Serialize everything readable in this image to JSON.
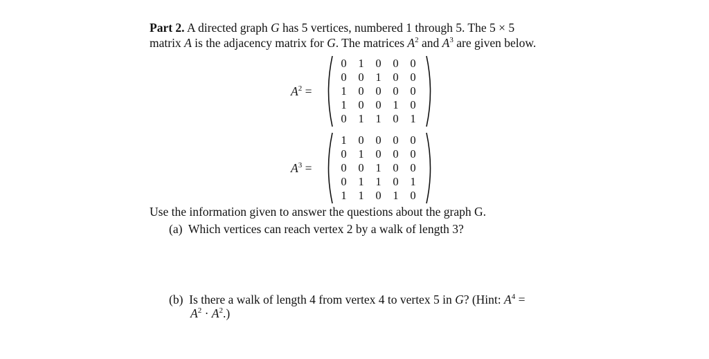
{
  "intro": {
    "part_label": "Part 2.",
    "line1_text_a": " A directed graph ",
    "graph_symbol": "G",
    "line1_text_b": " has 5 vertices, numbered 1 through 5.  The 5 × 5",
    "line2_text_a": "matrix ",
    "matrix_symbol": "A",
    "line2_text_b": " is the adjacency matrix for ",
    "line2_text_c": ". The matrices ",
    "a2_base": "A",
    "a2_exp": "2",
    "line2_text_d": " and ",
    "a3_base": "A",
    "a3_exp": "3",
    "line2_text_e": " are given below."
  },
  "matrices": [
    {
      "label_base": "A",
      "label_exp": "2",
      "equals": " =",
      "rows": [
        [
          "0",
          "1",
          "0",
          "0",
          "0"
        ],
        [
          "0",
          "0",
          "1",
          "0",
          "0"
        ],
        [
          "1",
          "0",
          "0",
          "0",
          "0"
        ],
        [
          "1",
          "0",
          "0",
          "1",
          "0"
        ],
        [
          "0",
          "1",
          "1",
          "0",
          "1"
        ]
      ]
    },
    {
      "label_base": "A",
      "label_exp": "3",
      "equals": " =",
      "rows": [
        [
          "1",
          "0",
          "0",
          "0",
          "0"
        ],
        [
          "0",
          "1",
          "0",
          "0",
          "0"
        ],
        [
          "0",
          "0",
          "1",
          "0",
          "0"
        ],
        [
          "0",
          "1",
          "1",
          "0",
          "1"
        ],
        [
          "1",
          "1",
          "0",
          "1",
          "0"
        ]
      ]
    }
  ],
  "instructions": "Use the information given to answer the questions about the graph G.",
  "questions": {
    "a": {
      "label": "(a)",
      "text": "Which vertices can reach vertex 2 by a walk of length 3?"
    },
    "b": {
      "label": "(b)",
      "text_a": "Is there a walk of length 4 from vertex 4 to vertex 5 in ",
      "graph_symbol": "G",
      "text_b": "?  (Hint:  ",
      "hint_base": "A",
      "hint_exp": "4",
      "hint_eq": " =",
      "line2_base1": "A",
      "line2_exp1": "2",
      "line2_dot": " · ",
      "line2_base2": "A",
      "line2_exp2": "2",
      "line2_end": ".)"
    }
  }
}
